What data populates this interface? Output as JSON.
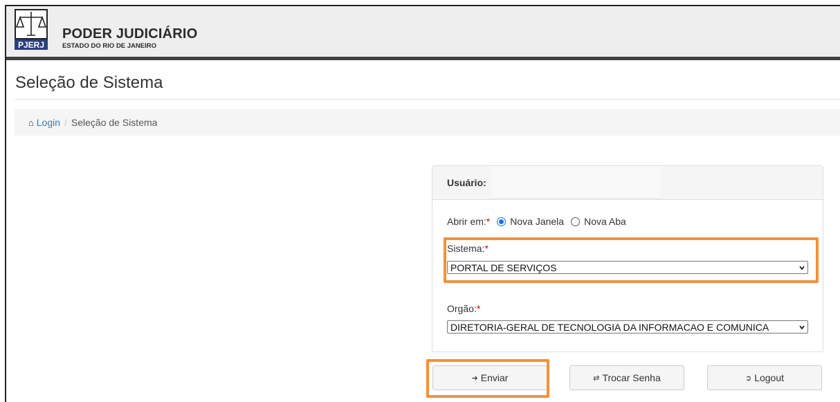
{
  "header": {
    "logo_text": "PJERJ",
    "title": "PODER JUDICIÁRIO",
    "subtitle": "ESTADO DO RIO DE JANEIRO"
  },
  "page": {
    "title": "Seleção de Sistema"
  },
  "breadcrumb": {
    "home_icon": "home-icon",
    "home_label": "Login",
    "separator": "/",
    "current": "Seleção de Sistema"
  },
  "panel": {
    "user_label": "Usuário:",
    "open_in": {
      "label": "Abrir em:",
      "required": "*",
      "options": [
        {
          "label": "Nova Janela",
          "selected": true
        },
        {
          "label": "Nova Aba",
          "selected": false
        }
      ]
    },
    "sistema": {
      "label": "Sistema:",
      "required": "*",
      "value": "PORTAL DE SERVIÇOS"
    },
    "orgao": {
      "label": "Orgão:",
      "required": "*",
      "value": "DIRETORIA-GERAL DE TECNOLOGIA DA INFORMACAO E COMUNICA"
    }
  },
  "buttons": {
    "enviar": "Enviar",
    "trocar_senha": "Trocar Senha",
    "logout": "Logout"
  },
  "colors": {
    "highlight": "#f0923e",
    "link": "#337ab7",
    "header_bg": "#eeeeee",
    "header_line": "#404040"
  }
}
